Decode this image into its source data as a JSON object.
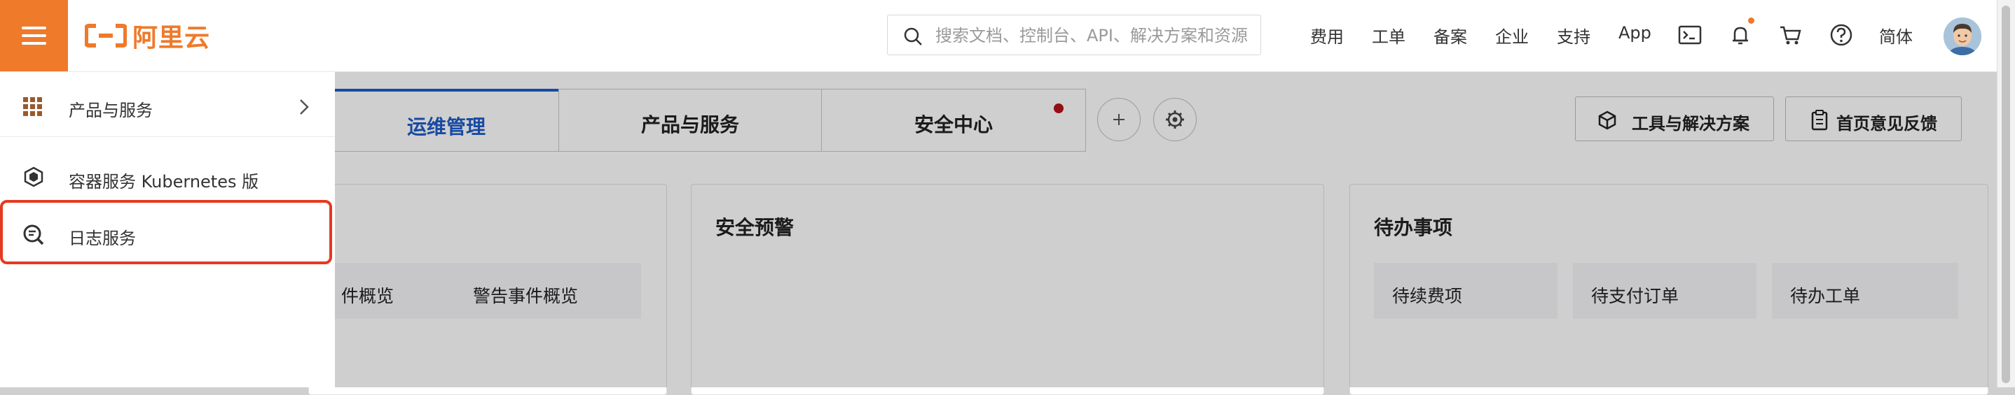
{
  "header": {
    "logo_text": "阿里云",
    "search": {
      "placeholder": "搜索文档、控制台、API、解决方案和资源"
    },
    "nav_links": [
      "费用",
      "工单",
      "备案",
      "企业",
      "支持",
      "App"
    ],
    "language": "简体",
    "icons": [
      "terminal-icon",
      "bell-icon",
      "cart-icon",
      "help-icon"
    ],
    "colors": {
      "brand": "#ee7a2a",
      "notification": "#ee7a2a"
    }
  },
  "drawer": {
    "products_label": "产品与服务",
    "items": [
      {
        "label": "容器服务 Kubernetes 版",
        "icon": "kubernetes-icon"
      },
      {
        "label": "日志服务",
        "icon": "log-service-icon",
        "highlighted": true
      }
    ],
    "colors": {
      "highlight_border": "#e53a1f"
    }
  },
  "page": {
    "tabs": [
      {
        "label": "运维管理",
        "active": true
      },
      {
        "label": "产品与服务",
        "active": false
      },
      {
        "label": "安全中心",
        "active": false,
        "has_dot": true
      }
    ],
    "buttons": {
      "tools": "工具与解决方案",
      "feedback": "首页意见反馈"
    },
    "cards": [
      {
        "title": "",
        "chips": [
          "件概览",
          "警告事件概览"
        ]
      },
      {
        "title": "安全预警",
        "chips": []
      },
      {
        "title": "待办事项",
        "chips": [
          "待续费项",
          "待支付订单",
          "待办工单"
        ]
      }
    ],
    "colors": {
      "active_tab": "#1e5cc8",
      "alert_dot": "#b8121b"
    }
  }
}
